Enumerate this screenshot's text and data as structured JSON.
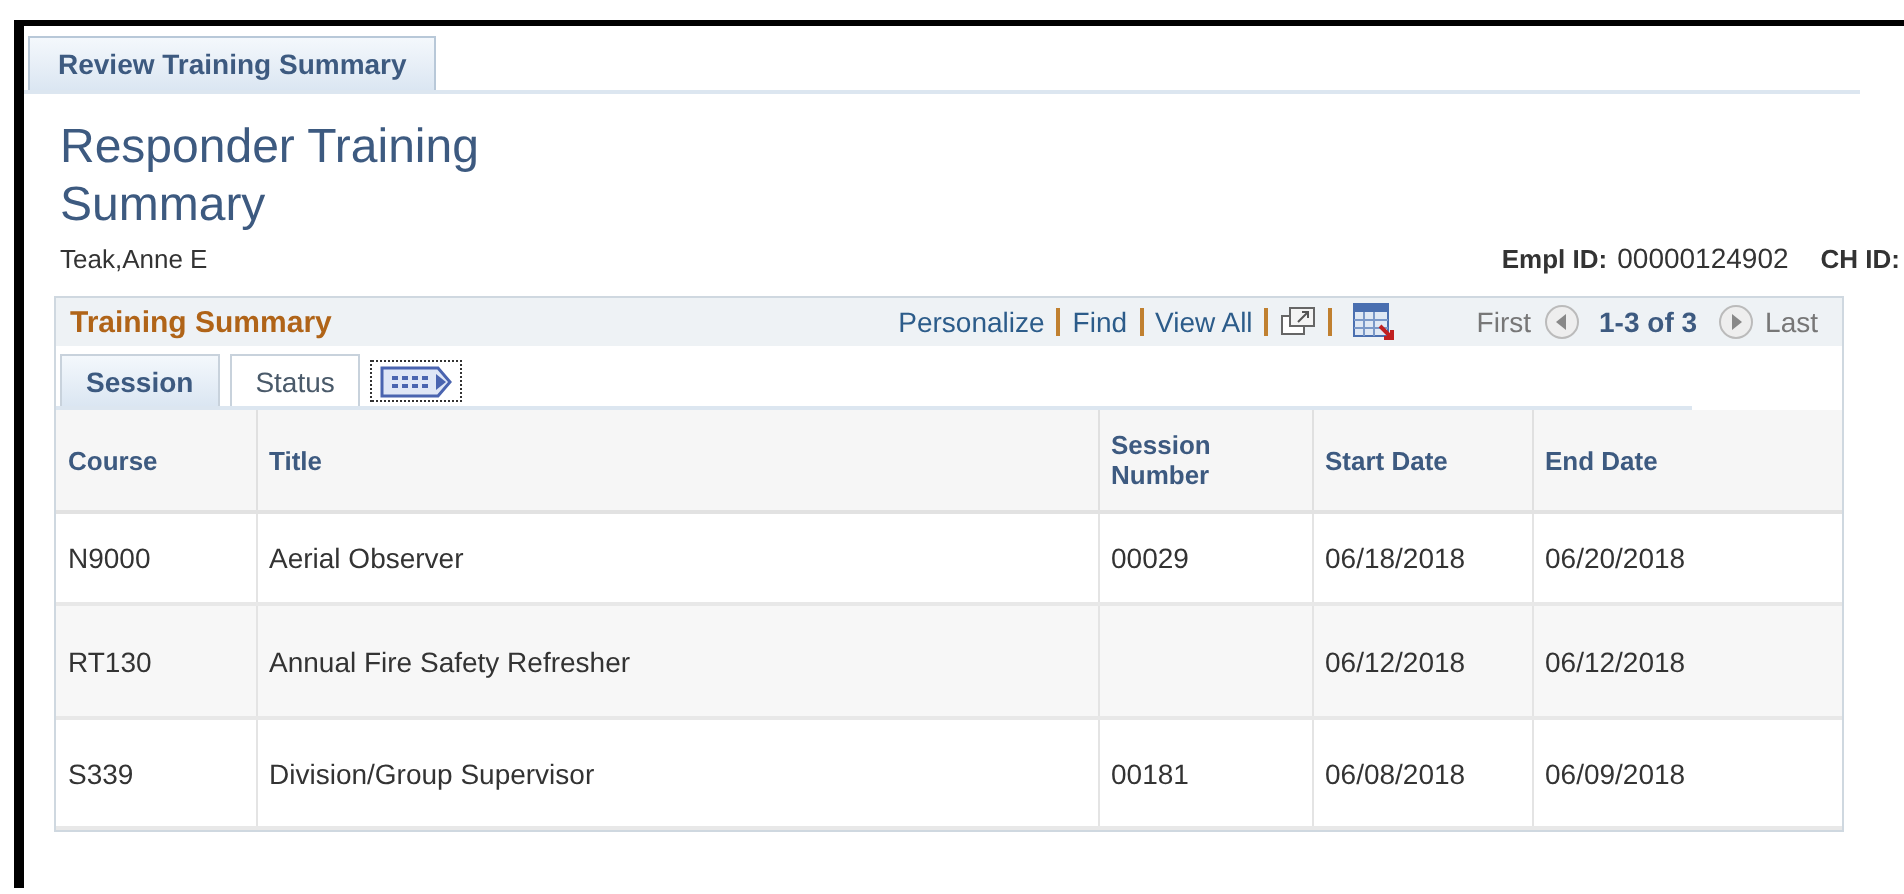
{
  "page_tabs": [
    {
      "label": "Review Training Summary",
      "selected": true
    }
  ],
  "title": "Responder Training Summary",
  "employee_name": "Teak,Anne E",
  "empl_id": {
    "label": "Empl ID:",
    "value": "00000124902"
  },
  "ch_id": {
    "label": "CH ID:"
  },
  "grid": {
    "title": "Training Summary",
    "links": [
      "Personalize",
      "Find",
      "View All"
    ],
    "nav": {
      "first": "First",
      "range": "1-3 of 3",
      "last": "Last"
    },
    "tabs": [
      {
        "label": "Session",
        "selected": true
      },
      {
        "label": "Status",
        "selected": false
      }
    ],
    "columns": [
      "Course",
      "Title",
      "Session Number",
      "Start Date",
      "End Date"
    ],
    "rows": [
      {
        "cells": [
          "N9000",
          "Aerial Observer",
          "00029",
          "06/18/2018",
          "06/20/2018"
        ]
      },
      {
        "cells": [
          "RT130",
          "Annual Fire Safety Refresher",
          "",
          "06/12/2018",
          "06/12/2018"
        ]
      },
      {
        "cells": [
          "S339",
          "Division/Group Supervisor",
          "00181",
          "06/08/2018",
          "06/09/2018"
        ]
      }
    ]
  }
}
